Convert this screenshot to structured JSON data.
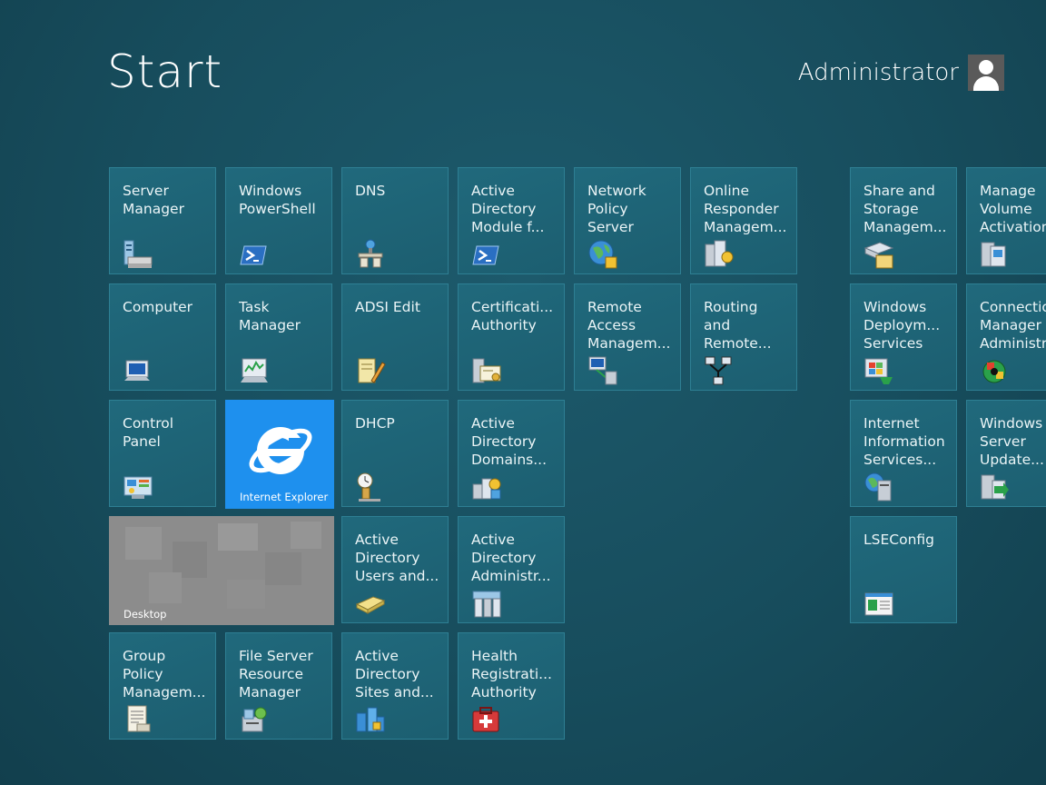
{
  "header": {
    "title": "Start",
    "user_name": "Administrator"
  },
  "tiles": {
    "server_manager": "Server\nManager",
    "windows_powershell": "Windows\nPowerShell",
    "dns": "DNS",
    "ad_module": "Active\nDirectory\nModule f...",
    "network_policy_server": "Network\nPolicy\nServer",
    "online_responder": "Online\nResponder\nManagem...",
    "computer": "Computer",
    "task_manager": "Task\nManager",
    "adsi_edit": "ADSI Edit",
    "certification_authority": "Certificati...\nAuthority",
    "remote_access": "Remote\nAccess\nManagem...",
    "routing_remote": "Routing\nand\nRemote...",
    "control_panel": "Control\nPanel",
    "internet_explorer": "Internet Explorer",
    "dhcp": "DHCP",
    "ad_domains": "Active\nDirectory\nDomains...",
    "desktop": "Desktop",
    "ad_users": "Active\nDirectory\nUsers and...",
    "ad_admin": "Active\nDirectory\nAdministr...",
    "group_policy": "Group\nPolicy\nManagem...",
    "fsrm": "File Server\nResource\nManager",
    "ad_sites": "Active\nDirectory\nSites and...",
    "health_registration": "Health\nRegistrati...\nAuthority",
    "share_storage": "Share and\nStorage\nManagem...",
    "volume_activation": "Manage\nVolume\nActivation...",
    "wds": "Windows\nDeploym...\nServices",
    "connection_manager": "Connection\nManager\nAdministr...",
    "iis": "Internet\nInformation\nServices...",
    "wsus": "Windows\nServer\nUpdate...",
    "lseconfig": "LSEConfig"
  },
  "colors": {
    "background": "#174d5d",
    "tile": "#1f6679",
    "tile_border": "#2e7f93",
    "ie_tile": "#1e90ee",
    "desktop_tile": "#8c8c8c"
  }
}
